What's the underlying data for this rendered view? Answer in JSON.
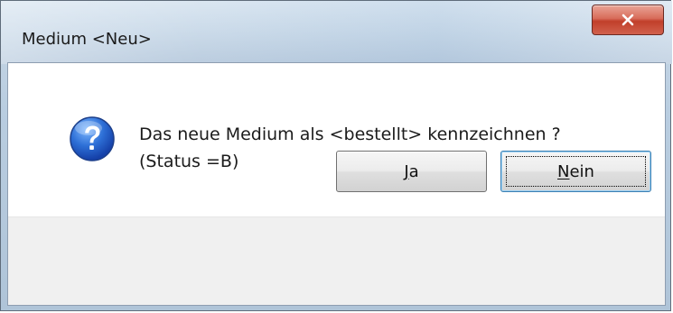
{
  "window": {
    "title": "Medium <Neu>",
    "close_icon": "close-icon"
  },
  "message": {
    "icon": "question-icon",
    "text": "Das neue Medium als <bestellt> kennzeichnen ?\n(Status =B)"
  },
  "buttons": {
    "yes": {
      "mnemonic": "J",
      "rest": "a"
    },
    "no": {
      "mnemonic": "N",
      "rest": "ein"
    }
  },
  "colors": {
    "close_button": "#c94d3a",
    "default_button_border": "#3c7fb1",
    "button_bar": "#f0f0f0"
  }
}
